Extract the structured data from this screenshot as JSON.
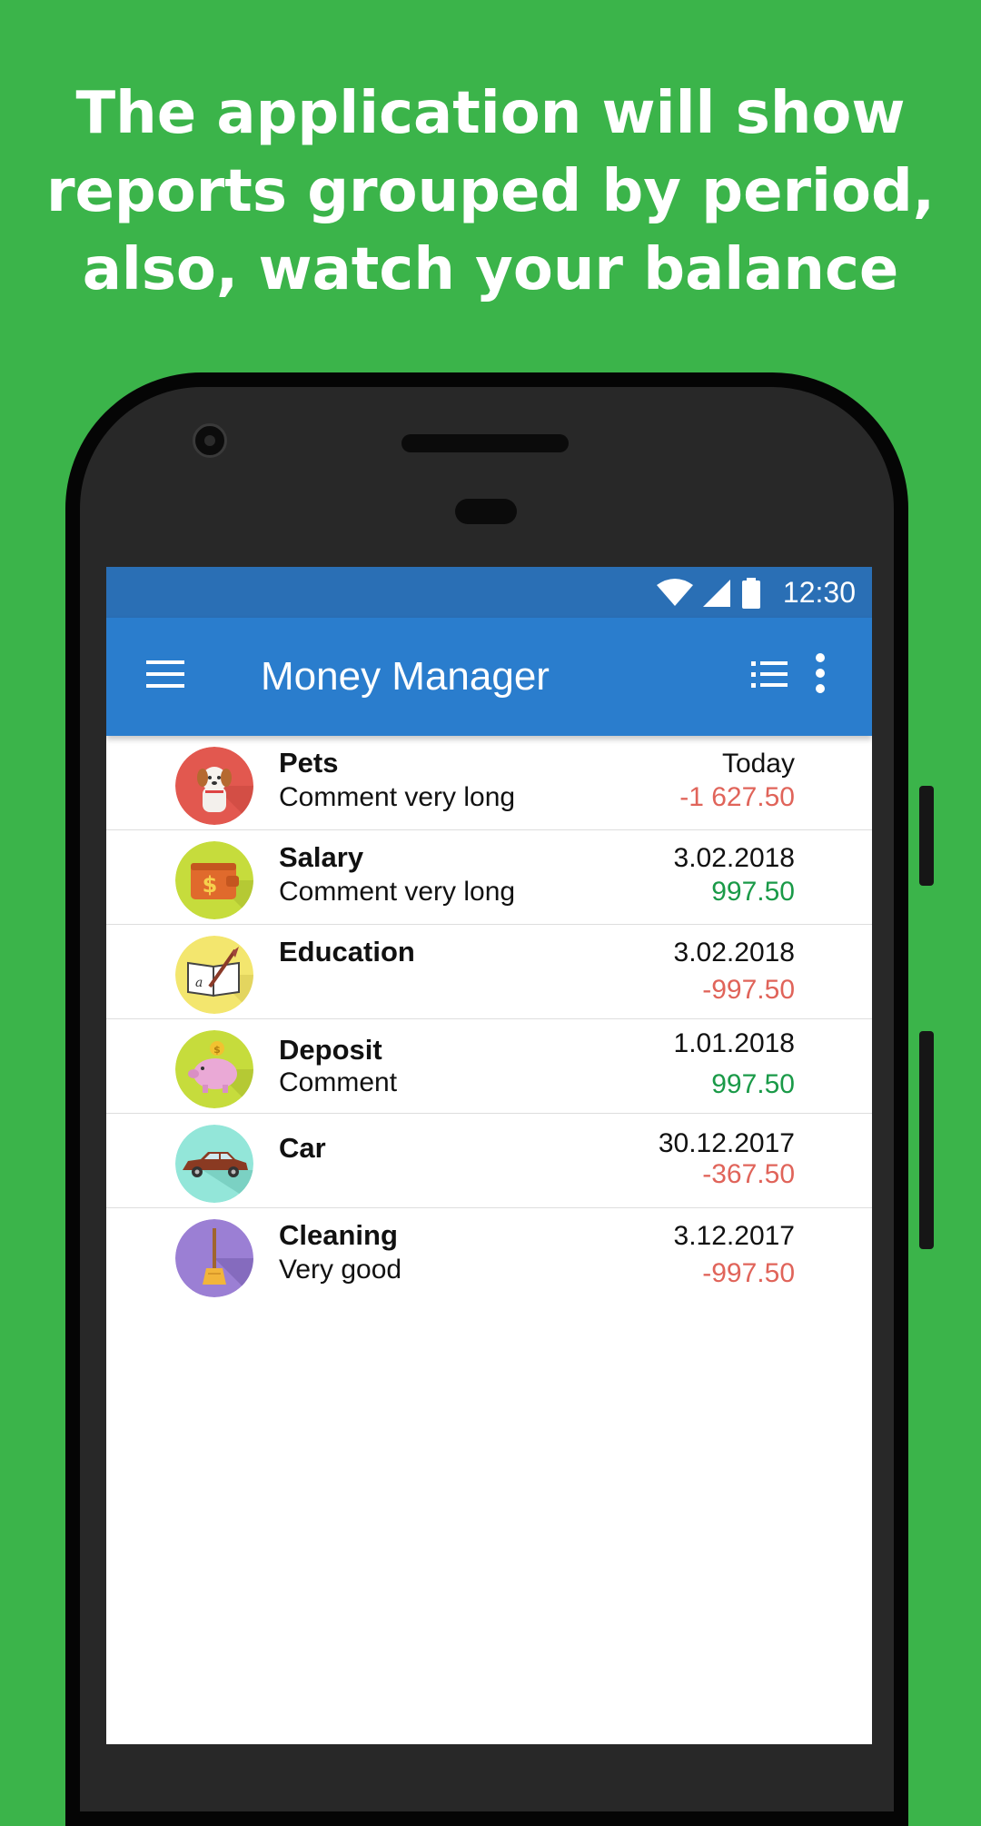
{
  "headline": {
    "line1": "The application will show",
    "line2": "reports grouped by period,",
    "line3": "also, watch your balance"
  },
  "status_bar": {
    "time": "12:30",
    "icons": [
      "wifi-icon",
      "cell-signal-icon",
      "battery-icon"
    ]
  },
  "app_bar": {
    "title": "Money Manager",
    "icons": [
      "hamburger-menu-icon",
      "list-view-icon",
      "more-vert-icon"
    ]
  },
  "colors": {
    "background": "#3bb44a",
    "status_bar": "#2a6fb5",
    "app_bar": "#2a7dcd",
    "expense": "#e0645a",
    "income": "#1a9a48"
  },
  "transactions": [
    {
      "category": "Pets",
      "comment": "Comment very long",
      "date": "Today",
      "amount": "-1 627.50",
      "type": "expense",
      "icon": "dog-icon"
    },
    {
      "category": "Salary",
      "comment": "Comment very long",
      "date": "3.02.2018",
      "amount": "997.50",
      "type": "income",
      "icon": "wallet-icon"
    },
    {
      "category": "Education",
      "comment": "",
      "date": "3.02.2018",
      "amount": "-997.50",
      "type": "expense",
      "icon": "book-quill-icon"
    },
    {
      "category": "Deposit",
      "comment": "Comment",
      "date": "1.01.2018",
      "amount": "997.50",
      "type": "income",
      "icon": "piggy-bank-icon"
    },
    {
      "category": "Car",
      "comment": "",
      "date": "30.12.2017",
      "amount": "-367.50",
      "type": "expense",
      "icon": "car-icon"
    },
    {
      "category": "Cleaning",
      "comment": "Very good",
      "date": "3.12.2017",
      "amount": "-997.50",
      "type": "expense",
      "icon": "broom-icon"
    }
  ]
}
